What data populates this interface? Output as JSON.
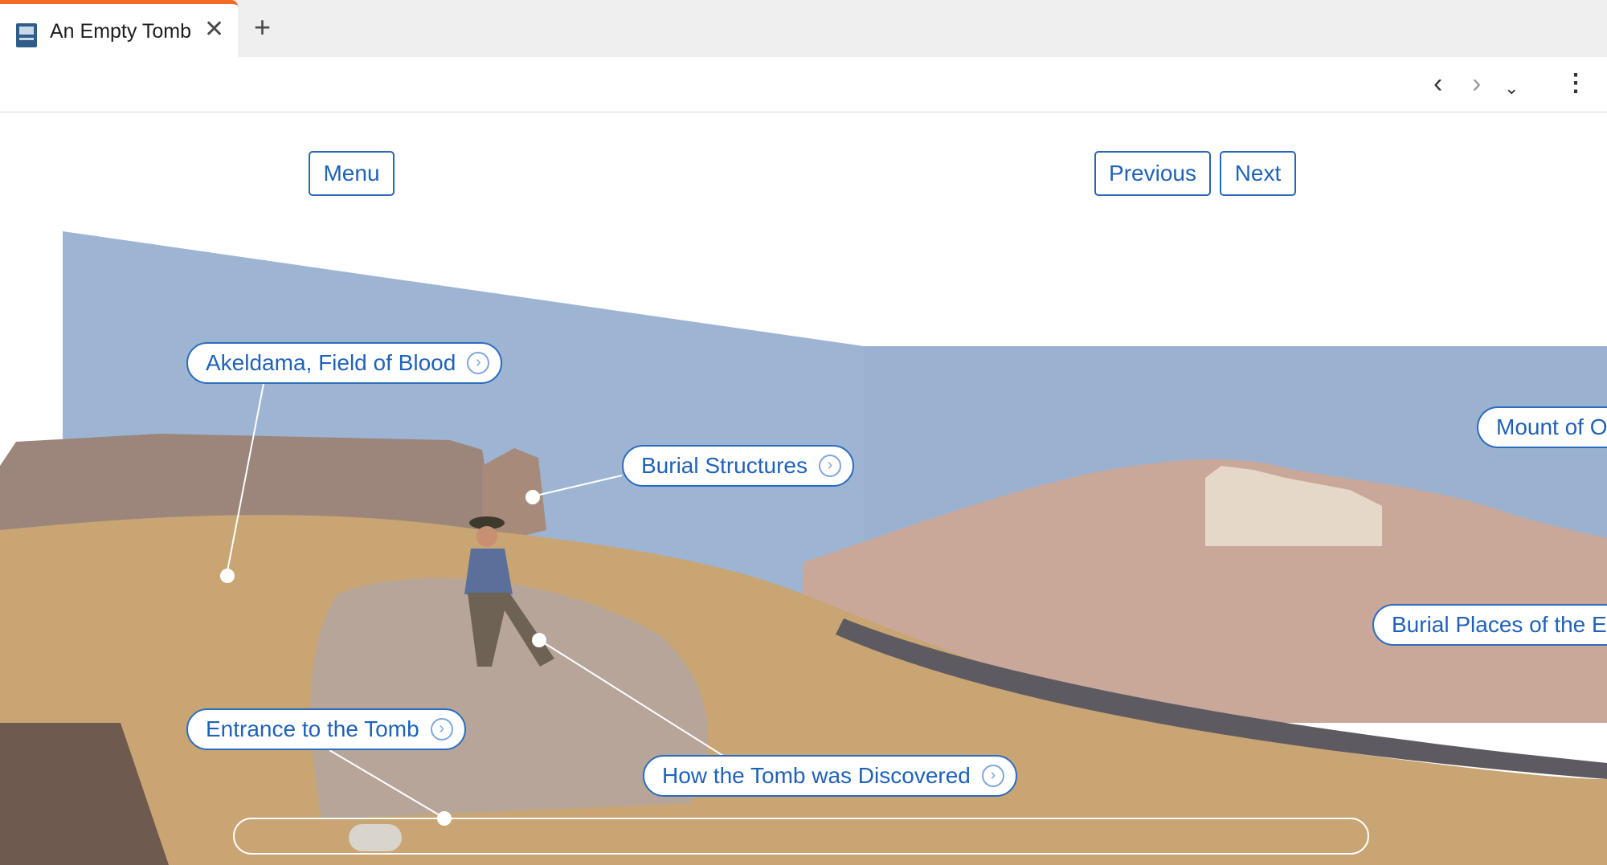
{
  "browser": {
    "tab_title": "An Empty Tomb",
    "tab_close_icon": "close-icon",
    "new_tab_icon": "plus-icon",
    "toolbar_icons": [
      "back-icon",
      "forward-icon",
      "dropdown-icon",
      "more-icon"
    ]
  },
  "page": {
    "menu_label": "Menu",
    "previous_label": "Previous",
    "next_label": "Next",
    "hotspots": [
      {
        "label": "Akeldama, Field of Blood"
      },
      {
        "label": "Burial Structures"
      },
      {
        "label": "Mount of O"
      },
      {
        "label": "Burial Places of the El"
      },
      {
        "label": "Entrance to the Tomb"
      },
      {
        "label": "How the Tomb was Discovered"
      }
    ],
    "arrow_icon": "chevron-circle-right-icon"
  },
  "colors": {
    "accent": "#1f62b8",
    "tab_indicator": "#f36b24",
    "sky": "#9bb2d2"
  }
}
